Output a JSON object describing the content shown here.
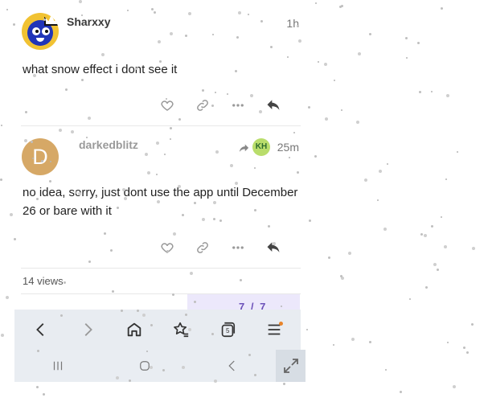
{
  "posts": [
    {
      "username": "Sharxxy",
      "time": "1h",
      "body": "what snow effect i dont see it"
    },
    {
      "username": "darkedblitz",
      "avatar_letter": "D",
      "time": "25m",
      "reply_to_initials": "KH",
      "body": "no idea, sorry, just dont use the app until December 26 or bare with it"
    }
  ],
  "topic": {
    "views": "14 views",
    "footer_text": "7 / 7"
  },
  "toolbar": {
    "tab_count": "5"
  },
  "colors": {
    "accent_orange": "#e8842a",
    "avatar_tan": "#d6a866",
    "avatar_yellow": "#f1c232",
    "toolbar_bg": "#e8ecf1",
    "snow": "#bfbfbf"
  },
  "icons": [
    "heart-icon",
    "link-icon",
    "more-icon",
    "reply-icon",
    "back-icon",
    "forward-icon",
    "home-icon",
    "bookmark-star-icon",
    "tabs-icon",
    "menu-icon",
    "recents-icon",
    "home-circle-icon",
    "expand-icon"
  ]
}
